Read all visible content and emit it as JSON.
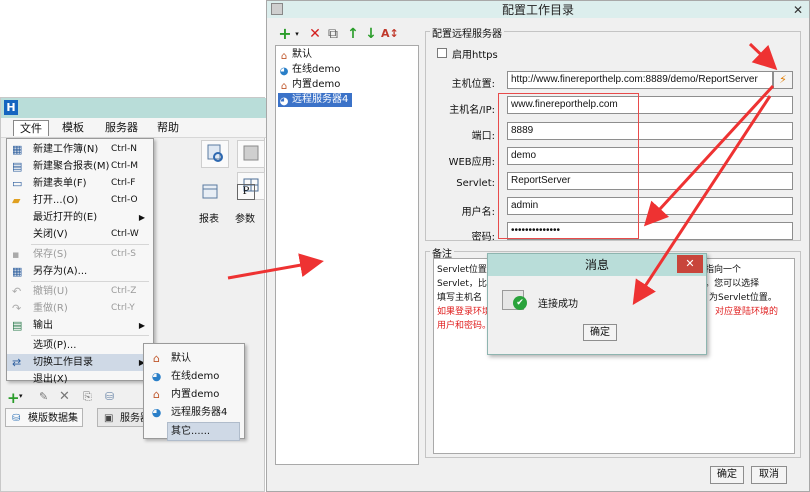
{
  "left_window": {
    "menus": [
      "文件",
      "模板",
      "服务器",
      "帮助"
    ],
    "file_menu": {
      "items": [
        {
          "label": "新建工作簿(N)",
          "shortcut": "Ctrl-N",
          "icon": "new-workbook-icon",
          "enabled": true
        },
        {
          "label": "新建聚合报表(M)",
          "shortcut": "Ctrl-M",
          "icon": "new-aggregate-report-icon",
          "enabled": true
        },
        {
          "label": "新建表单(F)",
          "shortcut": "Ctrl-F",
          "icon": "new-form-icon",
          "enabled": true
        },
        {
          "label": "打开...(O)",
          "shortcut": "Ctrl-O",
          "icon": "open-folder-icon",
          "enabled": true
        },
        {
          "label": "最近打开的(E)",
          "shortcut": "",
          "icon": "",
          "enabled": true,
          "submenu": true
        },
        {
          "label": "关闭(V)",
          "shortcut": "Ctrl-W",
          "icon": "",
          "enabled": true
        },
        {
          "label": "保存(S)",
          "shortcut": "Ctrl-S",
          "icon": "save-icon",
          "enabled": false
        },
        {
          "label": "另存为(A)...",
          "shortcut": "",
          "icon": "save-as-icon",
          "enabled": true
        },
        {
          "label": "撤销(U)",
          "shortcut": "Ctrl-Z",
          "icon": "undo-icon",
          "enabled": false
        },
        {
          "label": "重做(R)",
          "shortcut": "Ctrl-Y",
          "icon": "redo-icon",
          "enabled": false
        },
        {
          "label": "输出",
          "shortcut": "",
          "icon": "export-icon",
          "enabled": true,
          "submenu": true
        },
        {
          "label": "选项(P)...",
          "shortcut": "",
          "icon": "",
          "enabled": true
        },
        {
          "label": "切换工作目录",
          "shortcut": "",
          "icon": "switch-directory-icon",
          "enabled": true,
          "submenu": true,
          "highlighted": true
        },
        {
          "label": "退出(X)",
          "shortcut": "",
          "icon": "",
          "enabled": true
        }
      ]
    },
    "switch_submenu": [
      {
        "label": "默认",
        "icon": "home-icon"
      },
      {
        "label": "在线demo",
        "icon": "globe-icon"
      },
      {
        "label": "内置demo",
        "icon": "home-icon"
      },
      {
        "label": "远程服务器4",
        "icon": "globe-icon"
      },
      {
        "label": "其它......",
        "icon": "",
        "highlighted": true
      }
    ],
    "right_panel": {
      "report_label": "报表",
      "param_label": "参数"
    },
    "bottom_tabs": [
      "模版数据集",
      "服务器"
    ]
  },
  "dialog": {
    "title": "配置工作目录",
    "tree": [
      {
        "label": "默认",
        "icon": "home-icon"
      },
      {
        "label": "在线demo",
        "icon": "globe-icon"
      },
      {
        "label": "内置demo",
        "icon": "home-icon"
      },
      {
        "label": "远程服务器4",
        "icon": "globe-icon",
        "selected": true
      }
    ],
    "config_legend": "配置远程服务器",
    "https_label": "启用https",
    "fields": {
      "host_url_label": "主机位置:",
      "host_url_value": "http://www.finereporthelp.com:8889/demo/ReportServer",
      "hostname_label": "主机名/IP:",
      "hostname_value": "www.finereporthelp.com",
      "port_label": "端口:",
      "port_value": "8889",
      "webapp_label": "WEB应用:",
      "webapp_value": "demo",
      "servlet_label": "Servlet:",
      "servlet_value": "ReportServer",
      "username_label": "用户名:",
      "username_value": "admin",
      "password_label": "密码:",
      "password_value": "••••••••••••••"
    },
    "notes_legend": "备注",
    "notes": {
      "line1": "Servlet位置",
      "line1_tail": "指向一个",
      "line2": "Servlet，比",
      "line2_tail": "\"。您可以选择",
      "line3": "填写主机名",
      "line3_tail": "为Servlet位置。",
      "line4": "如果登录环境",
      "line4_tail": "对应登陆环境的",
      "line5": "用户和密码。"
    },
    "ok_label": "确定",
    "cancel_label": "取消"
  },
  "message_box": {
    "title": "消息",
    "text": "连接成功",
    "ok_label": "确定",
    "close_glyph": "✕"
  },
  "colors": {
    "annotation_red": "#ee3232",
    "title_bar": "#b9ddd9",
    "selection_blue": "#3b72c8"
  }
}
